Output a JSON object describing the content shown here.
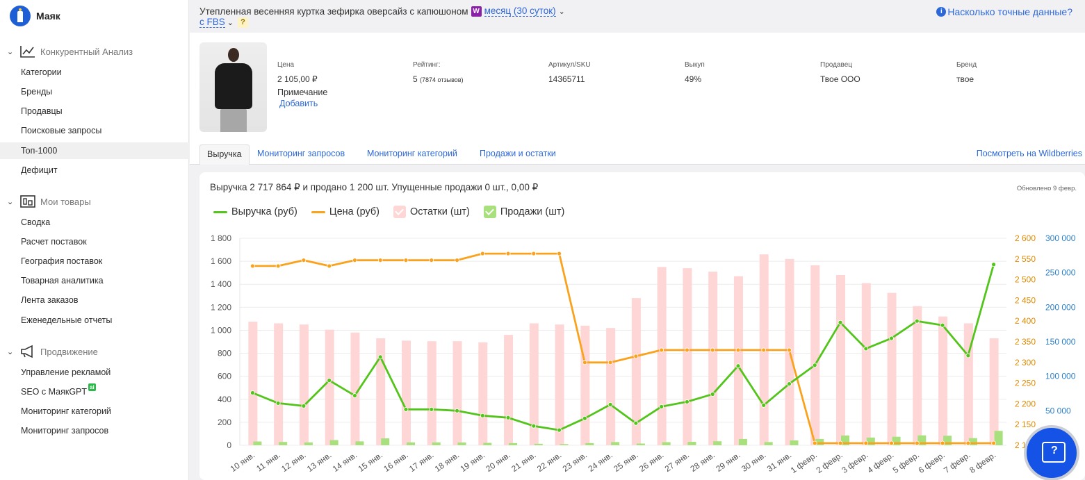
{
  "app": {
    "name": "Маяк"
  },
  "sidebar": {
    "sections": [
      {
        "title": "Конкурентный Анализ",
        "items": [
          "Категории",
          "Бренды",
          "Продавцы",
          "Поисковые запросы",
          "Топ-1000",
          "Дефицит"
        ],
        "active": "Топ-1000"
      },
      {
        "title": "Мои товары",
        "items": [
          "Сводка",
          "Расчет поставок",
          "География поставок",
          "Товарная аналитика",
          "Лента заказов",
          "Еженедельные отчеты"
        ]
      },
      {
        "title": "Продвижение",
        "items": [
          "Управление рекламой",
          "SEO с МаякGPT",
          "Мониторинг категорий",
          "Мониторинг запросов"
        ]
      }
    ],
    "ai_badge": "ai"
  },
  "header": {
    "product_title": "Утепленная весенняя куртка зефирка оверсайз с капюшоном",
    "marketplace_badge": "W",
    "period": "месяц (30 суток)",
    "fulfillment": "с FBS",
    "help_badge": "?",
    "accuracy_link": "Насколько точные данные?"
  },
  "product": {
    "fields": [
      {
        "label": "Цена",
        "value": "2 105,00 ₽"
      },
      {
        "label": "Рейтинг:",
        "value": "5",
        "extra": "(7874 отзывов)"
      },
      {
        "label": "Артикул/SKU",
        "value": "14365711"
      },
      {
        "label": "Выкуп",
        "value": "49%"
      },
      {
        "label": "Продавец",
        "value": "Твое ООО",
        "link": true
      },
      {
        "label": "Бренд",
        "value": "твое",
        "link": true
      }
    ],
    "note_label": "Примечание",
    "note_add": "Добавить"
  },
  "tabs": {
    "items": [
      "Выручка",
      "Мониторинг запросов",
      "Мониторинг категорий",
      "Продажи и остатки"
    ],
    "active": "Выручка",
    "right_link": "Посмотреть на Wildberries"
  },
  "chart_summary": {
    "text": "Выручка 2 717 864 ₽ и продано 1 200 шт.  Упущенные продажи 0 шт., 0,00 ₽",
    "updated": "Обновлено 9 февр."
  },
  "chart_data": {
    "type": "bar",
    "categories": [
      "10 янв.",
      "11 янв.",
      "12 янв.",
      "13 янв.",
      "14 янв.",
      "15 янв.",
      "16 янв.",
      "17 янв.",
      "18 янв.",
      "19 янв.",
      "20 янв.",
      "21 янв.",
      "22 янв.",
      "23 янв.",
      "24 янв.",
      "25 янв.",
      "26 янв.",
      "27 янв.",
      "28 янв.",
      "29 янв.",
      "30 янв.",
      "31 янв.",
      "1 февр.",
      "2 февр.",
      "3 февр.",
      "4 февр.",
      "5 февр.",
      "6 февр.",
      "7 февр.",
      "8 февр."
    ],
    "series": [
      {
        "name": "Выручка (руб)",
        "type": "line",
        "axis": "revenue",
        "color": "#52c41a",
        "values": [
          76000,
          61000,
          57000,
          94000,
          72000,
          128000,
          52000,
          52000,
          50000,
          43000,
          40000,
          28000,
          22000,
          39000,
          59000,
          32000,
          56000,
          63000,
          74000,
          115000,
          58000,
          89000,
          116000,
          178000,
          140000,
          155000,
          180000,
          174000,
          130000,
          262000
        ]
      },
      {
        "name": "Цена (руб)",
        "type": "line",
        "axis": "price",
        "color": "#faa21b",
        "values": [
          2533,
          2533,
          2547,
          2533,
          2547,
          2547,
          2547,
          2547,
          2547,
          2563,
          2563,
          2563,
          2563,
          2300,
          2300,
          2315,
          2330,
          2330,
          2330,
          2330,
          2330,
          2330,
          2105,
          2105,
          2105,
          2105,
          2105,
          2105,
          2105,
          2105
        ]
      },
      {
        "name": "Остатки (шт)",
        "type": "bar",
        "axis": "units",
        "color": "#ffd6d6",
        "values": [
          1075,
          1060,
          1050,
          1005,
          980,
          930,
          910,
          905,
          905,
          895,
          960,
          1060,
          1050,
          1040,
          1020,
          1280,
          1550,
          1540,
          1510,
          1470,
          1660,
          1620,
          1565,
          1480,
          1410,
          1325,
          1210,
          1120,
          1060,
          930
        ]
      },
      {
        "name": "Продажи (шт)",
        "type": "bar",
        "axis": "units",
        "color": "#a8e07d",
        "values": [
          33,
          29,
          25,
          45,
          34,
          60,
          25,
          25,
          24,
          21,
          19,
          13,
          10,
          19,
          28,
          15,
          27,
          30,
          35,
          55,
          28,
          42,
          55,
          85,
          67,
          74,
          86,
          83,
          62,
          125
        ]
      }
    ],
    "axes": {
      "units": {
        "min": 0,
        "max": 1800,
        "ticks": [
          "0",
          "200",
          "400",
          "600",
          "800",
          "1 000",
          "1 200",
          "1 400",
          "1 600",
          "1 800"
        ],
        "color": "#555555"
      },
      "price": {
        "min": 2100,
        "max": 2600,
        "ticks": [
          "2 100",
          "2 150",
          "2 200",
          "2 250",
          "2 300",
          "2 350",
          "2 400",
          "2 450",
          "2 500",
          "2 550",
          "2 600"
        ],
        "color": "#e08a00"
      },
      "revenue": {
        "min": 0,
        "max": 300000,
        "ticks": [
          "0",
          "50 000",
          "100 000",
          "150 000",
          "200 000",
          "250 000",
          "300 000"
        ],
        "color": "#2a7fc9"
      }
    },
    "grid": true,
    "legend_position": "top-left"
  },
  "colors": {
    "accent": "#2d68d8",
    "fab": "#1553e6"
  }
}
